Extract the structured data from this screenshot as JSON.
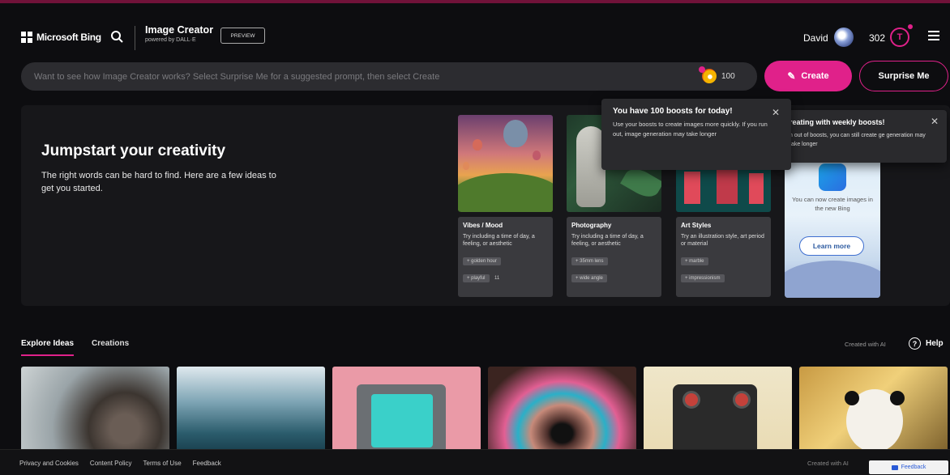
{
  "header": {
    "brand": "Microsoft Bing",
    "app_title": "Image Creator",
    "app_subtitle": "powered by DALL·E",
    "preview_badge": "PREVIEW",
    "user_name": "David",
    "reward_count": "302",
    "reward_icon": "rewards-trophy-icon",
    "accent_color": "#e0218a"
  },
  "prompt": {
    "placeholder": "Want to see how Image Creator works? Select Surprise Me for a suggested prompt, then select Create",
    "boost_count": "100",
    "create_label": "Create",
    "surprise_label": "Surprise Me"
  },
  "hero": {
    "title": "Jumpstart your creativity",
    "description": "The right words can be hard to find. Here are a few ideas to get you started.",
    "cards": [
      {
        "title": "Vibes / Mood",
        "description": "Try including a time of day, a feeling, or aesthetic",
        "chips": [
          "+ golden hour",
          "+ playful"
        ],
        "extra": "11"
      },
      {
        "title": "Photography",
        "description": "Try including a time of day, a feeling, or aesthetic",
        "chips": [
          "+ 35mm lens",
          "+ wide angle"
        ]
      },
      {
        "title": "Art Styles",
        "description": "Try an illustration style, art period or material",
        "chips": [
          "+ marble",
          "+ impressionism"
        ]
      }
    ],
    "boost_tooltip": {
      "title": "You have 100 boosts for today!",
      "description": "Use your boosts to create images more quickly. If you run out, image generation may take longer"
    },
    "weekly_tooltip": {
      "title": "reating with weekly boosts!",
      "description": "n out of boosts, you can still create ge generation may take longer"
    },
    "promo": {
      "text": "You can now create images in the new Bing",
      "button": "Learn more"
    }
  },
  "explore": {
    "tabs": [
      "Explore Ideas",
      "Creations"
    ],
    "active_tab": "Explore Ideas",
    "created_with": "Created with AI",
    "help": "Help"
  },
  "footer": {
    "links": [
      "Privacy and Cookies",
      "Content Policy",
      "Terms of Use",
      "Feedback"
    ],
    "created_with": "Created with AI",
    "feedback_button": "Feedback"
  }
}
